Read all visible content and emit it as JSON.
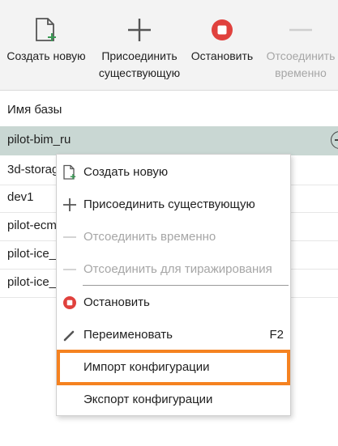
{
  "toolbar": {
    "create_new": "Создать новую",
    "attach_existing": "Присоединить\nсуществующую",
    "stop": "Остановить",
    "detach_temp": "Отсоединить\nвременно"
  },
  "table": {
    "column_header": "Имя базы",
    "rows": [
      "pilot-bim_ru",
      "3d-storag",
      "dev1",
      "pilot-ecm",
      "pilot-ice_",
      "pilot-ice_"
    ]
  },
  "context_menu": {
    "create_new": "Создать новую",
    "attach_existing": "Присоединить существующую",
    "detach_temp": "Отсоединить временно",
    "detach_replication": "Отсоединить для тиражирования",
    "stop": "Остановить",
    "rename": "Переименовать",
    "rename_shortcut": "F2",
    "import_config": "Импорт конфигурации",
    "export_config": "Экспорт конфигурации"
  },
  "colors": {
    "accent_highlight": "#f58220",
    "stop_red": "#e0413d",
    "selected_row": "#c9d7d3",
    "icon_green": "#3a9a55"
  }
}
